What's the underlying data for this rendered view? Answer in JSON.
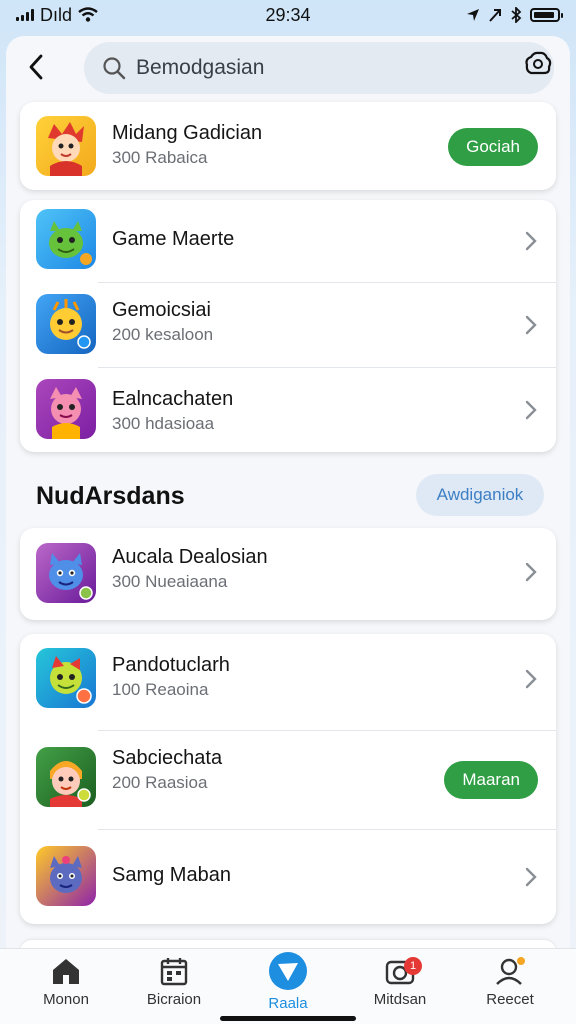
{
  "status_bar": {
    "carrier": "Dıld",
    "time": "29:34"
  },
  "search": {
    "text": "Bemodgasian"
  },
  "featured": {
    "title": "Midang Gadician",
    "subtitle": "300 Rabaica",
    "action": "Gociah"
  },
  "list1": [
    {
      "title": "Game Maerte",
      "subtitle": ""
    },
    {
      "title": "Gemoicsiai",
      "subtitle": "200 kesaloon"
    },
    {
      "title": "Ealncachaten",
      "subtitle": "300 hdasioaa"
    }
  ],
  "section": {
    "title": "NudArsdans",
    "action": "Awdiganiok"
  },
  "list2": [
    {
      "title": "Aucala Dealosian",
      "subtitle": "300 Nueaiaana"
    }
  ],
  "list3": [
    {
      "title": "Pandotuclarh",
      "subtitle": "100 Reaoina"
    },
    {
      "title": "Sabciechata",
      "subtitle": "200 Raasioa",
      "action": "Maaran"
    },
    {
      "title": "Samg Maban",
      "subtitle": ""
    }
  ],
  "nav": [
    {
      "label": "Monon",
      "icon": "home-icon"
    },
    {
      "label": "Bicraion",
      "icon": "calendar-icon"
    },
    {
      "label": "Raala",
      "icon": "play-icon"
    },
    {
      "label": "Mitdsan",
      "icon": "camera-icon",
      "badge": "1"
    },
    {
      "label": "Reecet",
      "icon": "profile-icon"
    }
  ],
  "colors": {
    "accent": "#1d8ee0",
    "green": "#2f9e44",
    "badge": "#e53935"
  }
}
